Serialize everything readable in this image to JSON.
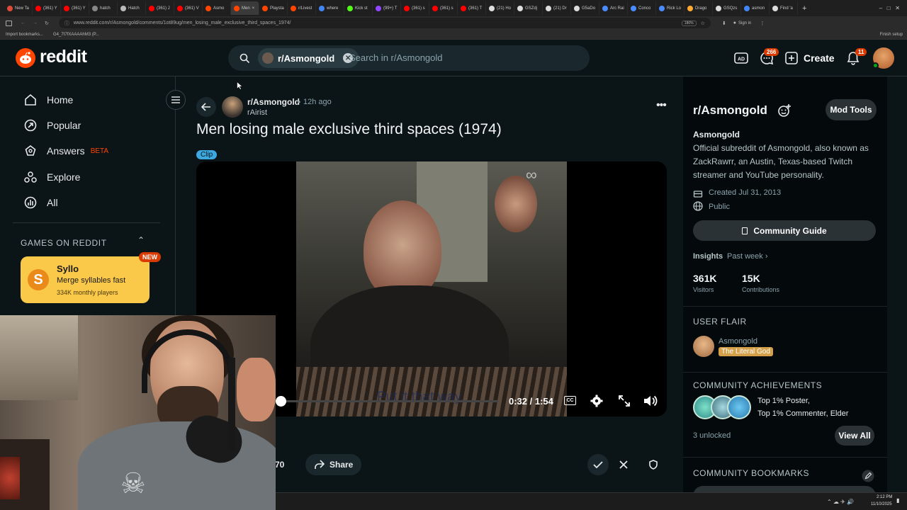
{
  "browser": {
    "tabs": [
      {
        "label": "New Ta",
        "color": "#e04a3a"
      },
      {
        "label": "(361) Y",
        "color": "#ff0000"
      },
      {
        "label": "(361) Y",
        "color": "#ff0000"
      },
      {
        "label": "hatch",
        "color": "#888888"
      },
      {
        "label": "Hatch",
        "color": "#bbbbbb"
      },
      {
        "label": "(361) J",
        "color": "#ff0000"
      },
      {
        "label": "(361) V",
        "color": "#ff0000"
      },
      {
        "label": "Asmo",
        "color": "#ff4500"
      },
      {
        "label": "Men",
        "color": "#ff4500",
        "active": true
      },
      {
        "label": "Playsta",
        "color": "#ff4500"
      },
      {
        "label": "r/Livest",
        "color": "#ff4500"
      },
      {
        "label": "where",
        "color": "#4285f4"
      },
      {
        "label": "Kick st",
        "color": "#53fc18"
      },
      {
        "label": "(99+) T",
        "color": "#9146ff"
      },
      {
        "label": "(361) s",
        "color": "#ff0000"
      },
      {
        "label": "(361) s",
        "color": "#ff0000"
      },
      {
        "label": "(361) T",
        "color": "#ff0000"
      },
      {
        "label": "(21) Ho",
        "color": "#dddddd"
      },
      {
        "label": "GSZdj",
        "color": "#dddddd"
      },
      {
        "label": "(21) Dr",
        "color": "#dddddd"
      },
      {
        "label": "G5aDo",
        "color": "#dddddd"
      },
      {
        "label": "Arc Rai",
        "color": "#4a8cff"
      },
      {
        "label": "Conco",
        "color": "#4a8cff"
      },
      {
        "label": "Rick Lo",
        "color": "#4a8cff"
      },
      {
        "label": "Drago",
        "color": "#ffaa33"
      },
      {
        "label": "GSQzs",
        "color": "#dddddd"
      },
      {
        "label": "asmon",
        "color": "#4285f4"
      },
      {
        "label": "Find 'a",
        "color": "#dddddd"
      }
    ],
    "url": "www.reddit.com/r/Asmongold/comments/1ot89ug/men_losing_male_exclusive_third_spaces_1974/",
    "zoom": "180%",
    "sign_in": "Sign in",
    "finish_setup": "Finish setup",
    "bookmarks": [
      "Import bookmarks...",
      "G4_7t7fXAAAAhM3 (P..."
    ]
  },
  "header": {
    "logo_text": "reddit",
    "search_chip": "r/Asmongold",
    "search_placeholder": "Search in r/Asmongold",
    "chat_badge": "266",
    "create_label": "Create",
    "notif_badge": "11"
  },
  "sidebar": {
    "items": [
      {
        "label": "Home"
      },
      {
        "label": "Popular"
      },
      {
        "label": "Answers",
        "tag": "BETA"
      },
      {
        "label": "Explore"
      },
      {
        "label": "All"
      }
    ],
    "games_heading": "GAMES ON REDDIT",
    "game": {
      "name": "Syllo",
      "desc": "Merge syllables fast",
      "players": "334K monthly players",
      "badge": "NEW"
    }
  },
  "post": {
    "subreddit": "r/Asmongold",
    "time": "12h ago",
    "author": "rAirist",
    "title": "Men losing male exclusive third spaces (1974)",
    "flair": "Clip",
    "video": {
      "time": "0:32 / 1:54",
      "caption": "Put it that way.",
      "progress": 0.28
    },
    "votes": "70",
    "share_label": "Share"
  },
  "community": {
    "name": "r/Asmongold",
    "mod_tools": "Mod Tools",
    "title": "Asmongold",
    "description": "Official subreddit of Asmongold, also known as ZackRawrr, an Austin, Texas-based Twitch streamer and YouTube personality.",
    "created": "Created Jul 31, 2013",
    "visibility": "Public",
    "guide_label": "Community Guide",
    "insights_label": "Insights",
    "insights_period": "Past week",
    "visitors_value": "361K",
    "visitors_label": "Visitors",
    "contrib_value": "15K",
    "contrib_label": "Contributions",
    "user_flair_heading": "USER FLAIR",
    "user_name": "Asmongold",
    "user_flair": "The Literal God",
    "achievements_heading": "COMMUNITY ACHIEVEMENTS",
    "achievement_line1": "Top 1% Poster,",
    "achievement_line2": "Top 1% Commenter, Elder",
    "unlocked": "3 unlocked",
    "view_all": "View All",
    "bookmarks_heading": "COMMUNITY BOOKMARKS"
  },
  "taskbar": {
    "time": "2:12 PM",
    "date": "11/10/2025"
  }
}
